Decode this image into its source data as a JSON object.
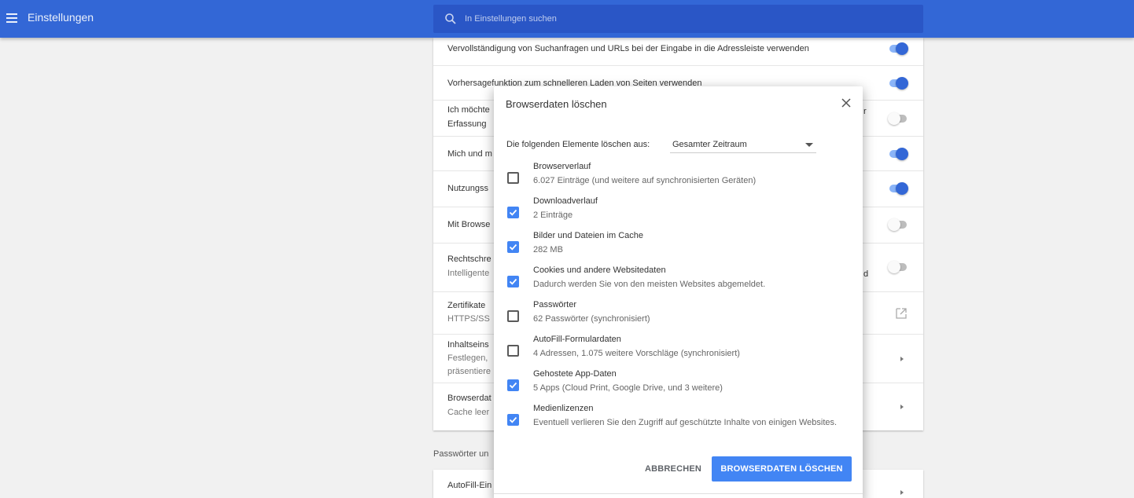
{
  "header": {
    "title": "Einstellungen",
    "search_placeholder": "In Einstellungen suchen"
  },
  "settings": {
    "rows": [
      {
        "line1": "Vervollständigung von Suchanfragen und URLs bei der Eingabe in die Adressleiste verwenden",
        "toggle": "on"
      },
      {
        "line1": "Vorhersagefunktion zum schnelleren Laden von Seiten verwenden",
        "toggle": "on"
      },
      {
        "line1": "Ich möchte",
        "line2": "Erfassung",
        "tail": "r",
        "toggle": "off"
      },
      {
        "line1": "Mich und m",
        "toggle": "on"
      },
      {
        "line1": "Nutzungss",
        "toggle": "on"
      },
      {
        "line1": "Mit Browse",
        "toggle": "off"
      },
      {
        "line1": "Rechtschre",
        "line2": "Intelligente",
        "tail": "d",
        "toggle": "off"
      },
      {
        "line1": "Zertifikate",
        "line2": "HTTPS/SS"
      },
      {
        "line1": "Inhaltseins",
        "line2": "Festlegen,",
        "line3": "präsentiere"
      },
      {
        "line1": "Browserdat",
        "line2": "Cache leer"
      }
    ],
    "section_heading": "Passwörter un",
    "autofill_row": "AutoFill-Ein"
  },
  "dialog": {
    "title": "Browserdaten löschen",
    "range_label": "Die folgenden Elemente löschen aus:",
    "range_value": "Gesamter Zeitraum",
    "items": [
      {
        "title": "Browserverlauf",
        "subtitle": "6.027 Einträge (und weitere auf synchronisierten Geräten)",
        "checked": false
      },
      {
        "title": "Downloadverlauf",
        "subtitle": "2 Einträge",
        "checked": true
      },
      {
        "title": "Bilder und Dateien im Cache",
        "subtitle": "282 MB",
        "checked": true
      },
      {
        "title": "Cookies und andere Websitedaten",
        "subtitle": "Dadurch werden Sie von den meisten Websites abgemeldet.",
        "checked": true
      },
      {
        "title": "Passwörter",
        "subtitle": "62 Passwörter (synchronisiert)",
        "checked": false
      },
      {
        "title": "AutoFill-Formulardaten",
        "subtitle": "4 Adressen, 1.075 weitere Vorschläge (synchronisiert)",
        "checked": false
      },
      {
        "title": "Gehostete App-Daten",
        "subtitle": "5 Apps (Cloud Print, Google Drive, und 3 weitere)",
        "checked": true
      },
      {
        "title": "Medienlizenzen",
        "subtitle": "Eventuell verlieren Sie den Zugriff auf geschützte Inhalte von einigen Websites.",
        "checked": true
      }
    ],
    "cancel_label": "ABBRECHEN",
    "confirm_label": "BROWSERDATEN LÖSCHEN"
  },
  "colors": {
    "header": "#3367d6",
    "accent": "#4285f4",
    "toggle_on": "#3367d6"
  },
  "icons": [
    "menu-icon",
    "search-icon",
    "close-icon",
    "dropdown-arrow-icon",
    "check-icon",
    "open-in-new-icon",
    "chevron-right-icon"
  ]
}
